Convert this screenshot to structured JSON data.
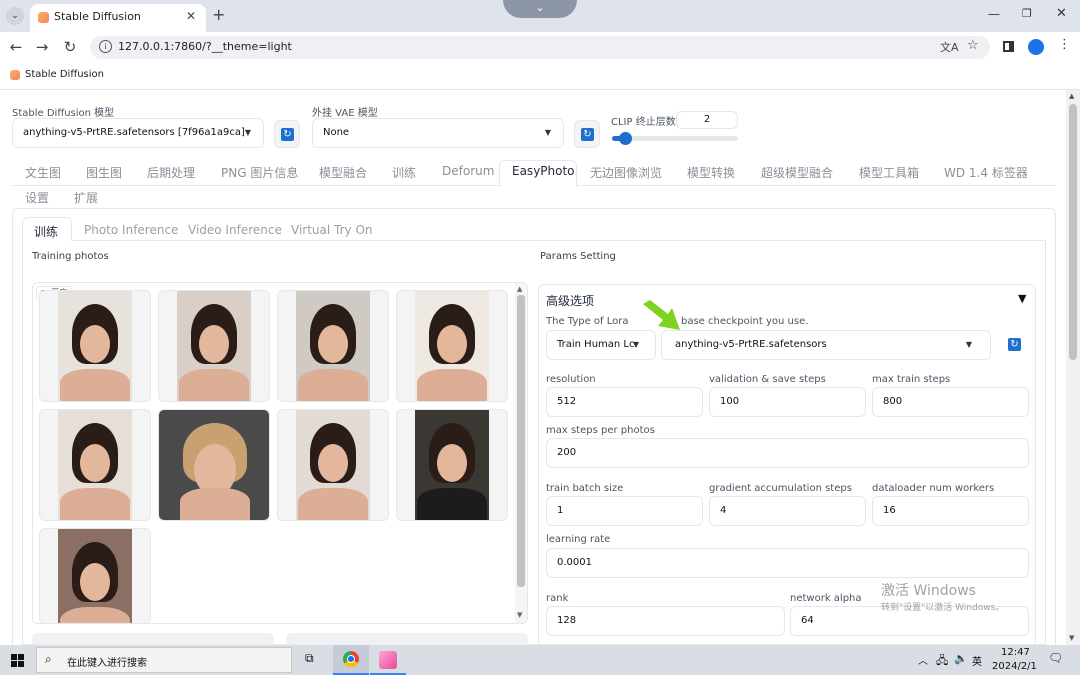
{
  "browser": {
    "tab_title": "Stable Diffusion",
    "url": "127.0.0.1:7860/?__theme=light",
    "bookmark": "Stable Diffusion"
  },
  "top": {
    "sd_model_label": "Stable Diffusion 模型",
    "sd_model_value": "anything-v5-PrtRE.safetensors [7f96a1a9ca]",
    "vae_label": "外挂 VAE 模型",
    "vae_value": "None",
    "clip_label": "CLIP 终止层数",
    "clip_value": "2",
    "clip_slider_fraction": 0.1
  },
  "main_tabs": [
    "文生图",
    "图生图",
    "后期处理",
    "PNG 图片信息",
    "模型融合",
    "训练",
    "Deforum",
    "EasyPhoto",
    "无边图像浏览",
    "模型转换",
    "超级模型融合",
    "模型工具箱",
    "WD 1.4 标签器",
    "设置",
    "扩展"
  ],
  "sub_tabs": [
    "训练",
    "Photo Inference",
    "Video Inference",
    "Virtual Try On"
  ],
  "left": {
    "title": "Training photos",
    "gallery_label": "画廊"
  },
  "right": {
    "title": "Params Setting",
    "accordion_title": "高级选项",
    "lora_type_label": "The Type of Lora",
    "checkpoint_label": "base checkpoint you use.",
    "lora_type_value": "Train Human Lc",
    "checkpoint_value": "anything-v5-PrtRE.safetensors",
    "fields": {
      "resolution": {
        "label": "resolution",
        "value": "512"
      },
      "val_steps": {
        "label": "validation & save steps",
        "value": "100"
      },
      "max_train": {
        "label": "max train steps",
        "value": "800"
      },
      "max_per_photo": {
        "label": "max steps per photos",
        "value": "200"
      },
      "batch": {
        "label": "train batch size",
        "value": "1"
      },
      "grad_acc": {
        "label": "gradient accumulation steps",
        "value": "4"
      },
      "workers": {
        "label": "dataloader num workers",
        "value": "16"
      },
      "lr": {
        "label": "learning rate",
        "value": "0.0001"
      },
      "rank": {
        "label": "rank",
        "value": "128"
      },
      "alpha": {
        "label": "network alpha",
        "value": "64"
      }
    }
  },
  "watermark": {
    "line1": "激活 Windows",
    "line2": "转到\"设置\"以激活 Windows。"
  },
  "taskbar": {
    "search_placeholder": "在此键入进行搜索",
    "lang": "英",
    "time": "12:47",
    "date": "2024/2/1"
  },
  "colors": {
    "accent": "#1e6fd0",
    "arrow": "#7ed321",
    "tab_border": "#e5e7eb"
  }
}
